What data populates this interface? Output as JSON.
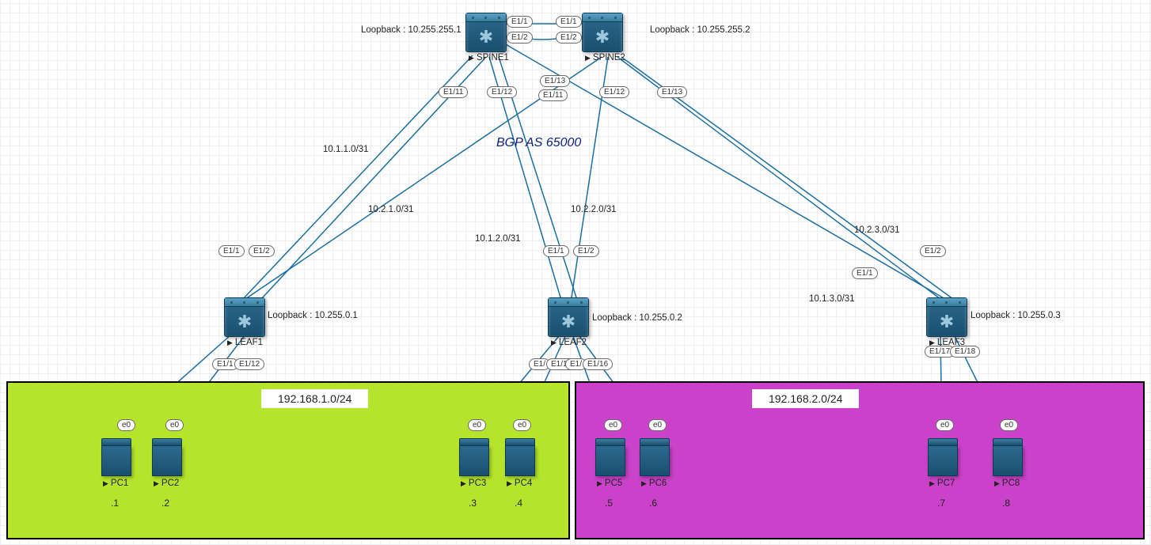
{
  "topology": {
    "as_label": "BGP AS 65000",
    "spines": [
      {
        "name": "SPINE1",
        "loopback": "Loopback : 10.255.255.1"
      },
      {
        "name": "SPINE2",
        "loopback": "Loopback : 10.255.255.2"
      }
    ],
    "leafs": [
      {
        "name": "LEAF1",
        "loopback": "Loopback : 10.255.0.1"
      },
      {
        "name": "LEAF2",
        "loopback": "Loopback : 10.255.0.2"
      },
      {
        "name": "LEAF3",
        "loopback": "Loopback : 10.255.0.3"
      }
    ],
    "hosts": [
      {
        "name": "PC1",
        "port": "e0",
        "ip": ".1"
      },
      {
        "name": "PC2",
        "port": "e0",
        "ip": ".2"
      },
      {
        "name": "PC3",
        "port": "e0",
        "ip": ".3"
      },
      {
        "name": "PC4",
        "port": "e0",
        "ip": ".4"
      },
      {
        "name": "PC5",
        "port": "e0",
        "ip": ".5"
      },
      {
        "name": "PC6",
        "port": "e0",
        "ip": ".6"
      },
      {
        "name": "PC7",
        "port": "e0",
        "ip": ".7"
      },
      {
        "name": "PC8",
        "port": "e0",
        "ip": ".8"
      }
    ],
    "subnets": [
      {
        "cidr": "192.168.1.0/24",
        "color": "#b6e42c"
      },
      {
        "cidr": "192.168.2.0/24",
        "color": "#c942c9"
      }
    ],
    "spine_interlinks": {
      "a": "E1/1",
      "b": "E1/2"
    },
    "spine_ports": {
      "spine1": {
        "l1": "E1/11",
        "l2": "E1/12",
        "l3": "E1/13"
      },
      "spine2": {
        "l1": "E1/11",
        "l2": "E1/12",
        "l3": "E1/13"
      }
    },
    "leaf_uplink_ports": {
      "a": "E1/1",
      "b": "E1/2"
    },
    "fabric_links": [
      {
        "subnet": "10.1.1.0/31"
      },
      {
        "subnet": "10.2.1.0/31"
      },
      {
        "subnet": "10.1.2.0/31"
      },
      {
        "subnet": "10.2.2.0/31"
      },
      {
        "subnet": "10.1.3.0/31"
      },
      {
        "subnet": "10.2.3.0/31"
      }
    ],
    "leaf_access_ports": {
      "leaf1": [
        "E1/11",
        "E1/12"
      ],
      "leaf2": [
        "E1/13",
        "E1/14",
        "E1/15",
        "E1/16"
      ],
      "leaf3": [
        "E1/17",
        "E1/18"
      ]
    }
  },
  "iface_display": {
    "leaf1_access": [
      "E1/1",
      "E1/12"
    ],
    "leaf2_access": [
      "E1/",
      "E1/14",
      "E1/",
      "E1/16"
    ]
  }
}
